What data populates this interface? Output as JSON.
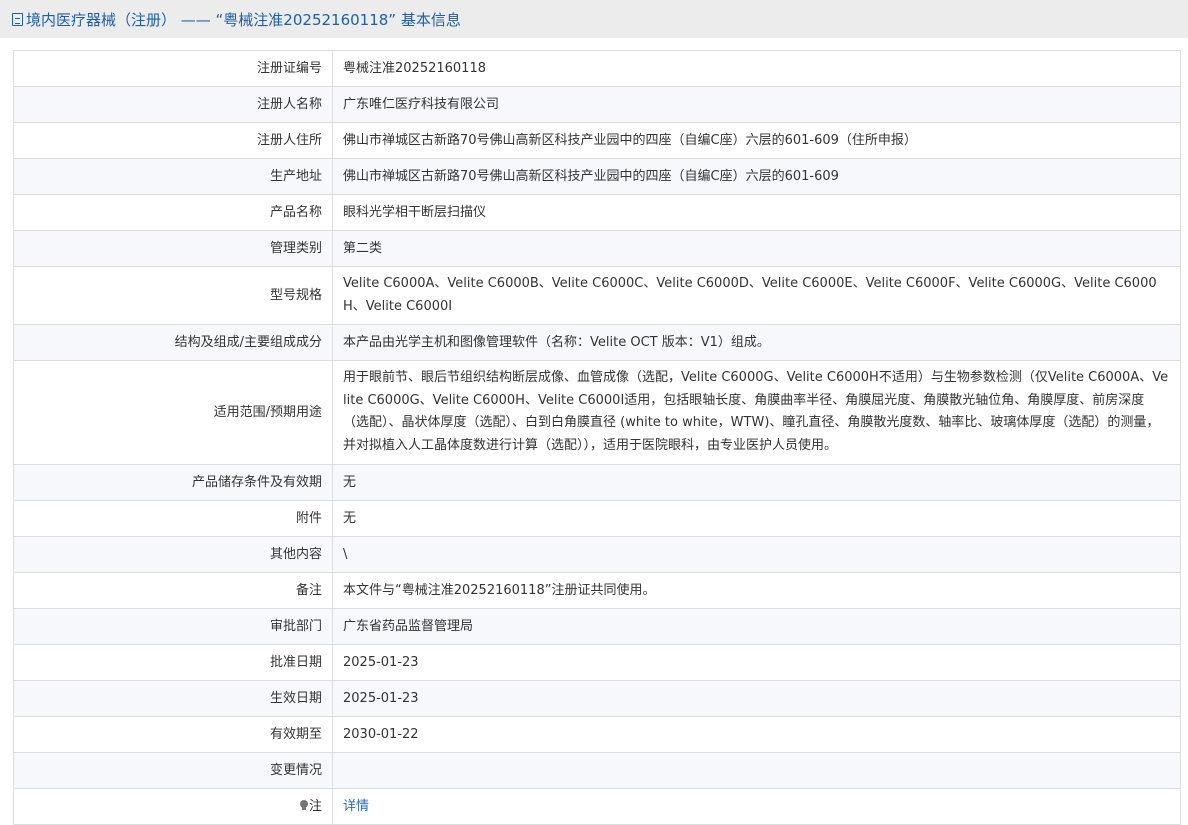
{
  "header": {
    "title": "境内医疗器械（注册） —— “粤械注准20252160118” 基本信息"
  },
  "rows": [
    {
      "label": "注册证编号",
      "value": "粤械注准20252160118"
    },
    {
      "label": "注册人名称",
      "value": "广东唯仁医疗科技有限公司"
    },
    {
      "label": "注册人住所",
      "value": "佛山市禅城区古新路70号佛山高新区科技产业园中的四座（自编C座）六层的601-609（住所申报）"
    },
    {
      "label": "生产地址",
      "value": "佛山市禅城区古新路70号佛山高新区科技产业园中的四座（自编C座）六层的601-609"
    },
    {
      "label": "产品名称",
      "value": "眼科光学相干断层扫描仪"
    },
    {
      "label": "管理类别",
      "value": "第二类"
    },
    {
      "label": "型号规格",
      "value": "Velite C6000A、Velite C6000B、Velite C6000C、Velite C6000D、Velite C6000E、Velite C6000F、Velite C6000G、Velite C6000H、Velite C6000I"
    },
    {
      "label": "结构及组成/主要组成成分",
      "value": "本产品由光学主机和图像管理软件（名称：Velite OCT 版本：V1）组成。"
    },
    {
      "label": "适用范围/预期用途",
      "value": "用于眼前节、眼后节组织结构断层成像、血管成像（选配，Velite C6000G、Velite C6000H不适用）与生物参数检测（仅Velite C6000A、Velite C6000G、Velite C6000H、Velite C6000I适用，包括眼轴长度、角膜曲率半径、角膜屈光度、角膜散光轴位角、角膜厚度、前房深度（选配）、晶状体厚度（选配）、白到白角膜直径 (white to white，WTW)、瞳孔直径、角膜散光度数、轴率比、玻璃体厚度（选配）的测量，并对拟植入人工晶体度数进行计算（选配）），适用于医院眼科，由专业医护人员使用。"
    },
    {
      "label": "产品储存条件及有效期",
      "value": "无"
    },
    {
      "label": "附件",
      "value": "无"
    },
    {
      "label": "其他内容",
      "value": "\\"
    },
    {
      "label": "备注",
      "value": "本文件与“粤械注准20252160118”注册证共同使用。"
    },
    {
      "label": "审批部门",
      "value": "广东省药品监督管理局"
    },
    {
      "label": "批准日期",
      "value": "2025-01-23"
    },
    {
      "label": "生效日期",
      "value": "2025-01-23"
    },
    {
      "label": "有效期至",
      "value": "2030-01-22"
    },
    {
      "label": "变更情况",
      "value": ""
    }
  ],
  "note": {
    "label": "注",
    "link_text": "详情"
  },
  "icons": {
    "header": "document-icon",
    "note": "lightbulb-icon"
  },
  "colors": {
    "link": "#2a6bb5",
    "header_text": "#1e5fa8",
    "header_bg": "#ececec"
  }
}
